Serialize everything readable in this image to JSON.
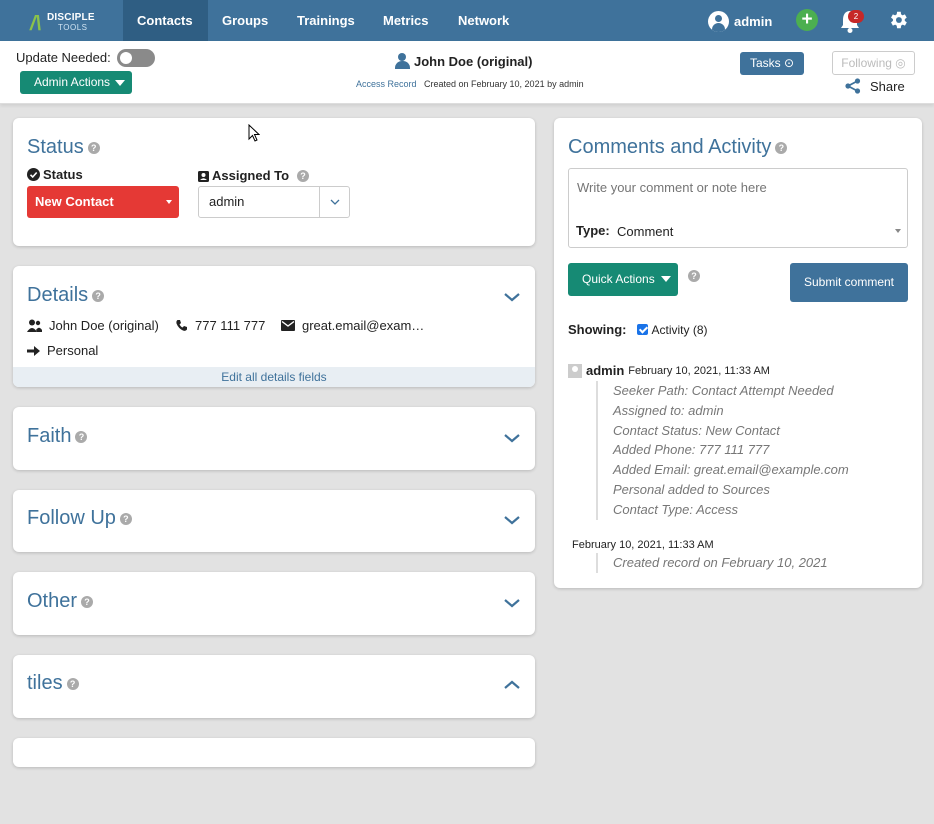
{
  "nav": {
    "logo_top": "DISCIPLE",
    "logo_bottom": "TOOLS",
    "items": [
      {
        "label": "Contacts"
      },
      {
        "label": "Groups"
      },
      {
        "label": "Trainings"
      },
      {
        "label": "Metrics"
      },
      {
        "label": "Network"
      }
    ],
    "user": "admin",
    "notification_count": "2"
  },
  "header": {
    "update_needed_label": "Update Needed:",
    "admin_actions_label": "Admin Actions",
    "contact_name": "John Doe (original)",
    "access_record": "Access Record",
    "created_on": "Created on February 10, 2021 by admin",
    "tasks_label": "Tasks ⊙",
    "following_label": "Following ◎",
    "share_label": "Share"
  },
  "status_card": {
    "title": "Status",
    "status_label": "Status",
    "status_value": "New Contact",
    "assigned_label": "Assigned To",
    "assigned_value": "admin"
  },
  "details_card": {
    "title": "Details",
    "name": "John Doe (original)",
    "phone": "777 111 777",
    "email": "great.email@exam…",
    "type": "Personal",
    "edit_all": "Edit all details fields"
  },
  "collapsed_cards": {
    "faith": "Faith",
    "follow_up": "Follow Up",
    "other": "Other",
    "tiles": "tiles"
  },
  "comments": {
    "title": "Comments and Activity",
    "placeholder": "Write your comment or note here",
    "type_label": "Type:",
    "type_value": "Comment",
    "quick_actions": "Quick Actions",
    "submit": "Submit comment",
    "showing_label": "Showing:",
    "activity_filter": "Activity (8)",
    "activities": [
      {
        "user": "admin",
        "date": "February 10, 2021, 11:33 AM",
        "lines": [
          "Seeker Path: Contact Attempt Needed",
          "Assigned to: admin",
          "Contact Status: New Contact",
          "Added Phone: 777 111 777",
          "Added Email: great.email@example.com",
          "Personal added to Sources",
          "Contact Type: Access"
        ]
      },
      {
        "user": "",
        "date": "February 10, 2021, 11:33 AM",
        "lines": [
          "Created record on February 10, 2021"
        ]
      }
    ]
  },
  "colors": {
    "primary": "#3f729b",
    "teal": "#168a74",
    "status_red": "#e53935",
    "add_green": "#4caf50"
  }
}
